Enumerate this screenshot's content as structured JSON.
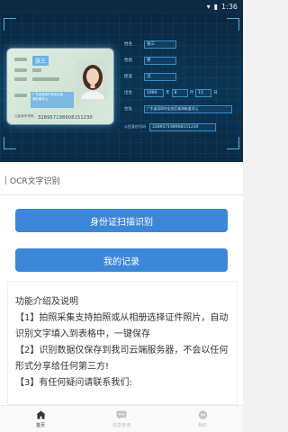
{
  "status_bar": {
    "time": "1:36",
    "wifi_icon": "wifi-icon",
    "battery_icon": "battery-icon"
  },
  "banner": {
    "card": {
      "name": "张三",
      "address_lines": [
        "广东省深圳市宝安区福",
        "海街道洋山"
      ],
      "id_label": "公民身份号码",
      "id_number": "328957198908151230"
    },
    "form": {
      "name_label": "姓名",
      "name_value": "张三",
      "gender_label": "性别",
      "gender_value": "男",
      "ethnicity_label": "民族",
      "ethnicity_value": "汉",
      "birth_label": "出生",
      "birth_year": "1989",
      "year_unit": "年",
      "birth_month": "8",
      "month_unit": "月",
      "birth_day": "15",
      "day_unit": "日",
      "address_label": "住址",
      "address_value": "广东省深圳市宝安区福海街道洋山",
      "id_label": "公民身份号码",
      "id_value": "328957198908151230"
    },
    "carousel_pages": 2,
    "carousel_active": 0
  },
  "section": {
    "title": "OCR文字识别"
  },
  "buttons": {
    "scan_label": "身份证扫描识别",
    "records_label": "我的记录"
  },
  "intro": {
    "heading": "功能介绍及说明",
    "line1": "【1】拍照采集支持拍照或从相册选择证件照片，自动识别文字填入到表格中，一键保存",
    "line2": "【2】识别数据仅保存到我司云端服务器，不会以任何形式分享给任何第三方!",
    "line3": "【3】有任何疑问请联系我们:"
  },
  "tabbar": {
    "items": [
      {
        "label": "首页",
        "icon": "home-icon",
        "active": true
      },
      {
        "label": "信息查询",
        "icon": "message-icon",
        "active": false
      },
      {
        "label": "我的",
        "icon": "profile-icon",
        "active": false
      }
    ]
  }
}
